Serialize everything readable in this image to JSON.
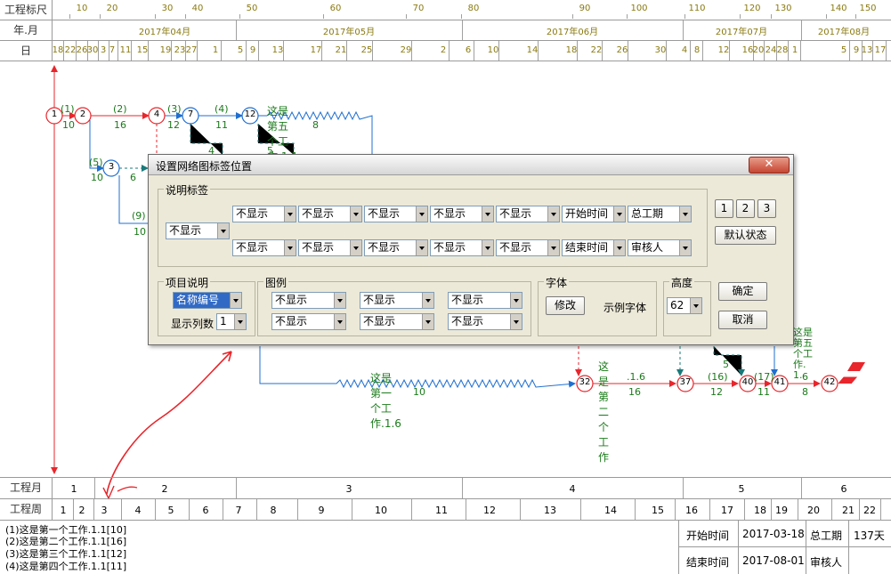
{
  "header": {
    "ruler_label": "工程标尺",
    "ruler_ticks": [
      "10",
      "20",
      "30",
      "40",
      "50",
      "60",
      "70",
      "80",
      "90",
      "100",
      "110",
      "120",
      "130",
      "140",
      "150"
    ],
    "month_label": "年.月",
    "months": [
      "2017年04月",
      "2017年05月",
      "2017年06月",
      "2017年07月",
      "2017年08月"
    ],
    "day_label": "日",
    "days": [
      "18",
      "22",
      "26",
      "30",
      "3",
      "7",
      "11",
      "15",
      "19",
      "23",
      "27",
      "1",
      "5",
      "9",
      "13",
      "17",
      "21",
      "25",
      "29",
      "2",
      "6",
      "10",
      "14",
      "18",
      "22",
      "26",
      "30",
      "4",
      "8",
      "12",
      "16",
      "20",
      "24",
      "28",
      "1",
      "5",
      "9",
      "13",
      "17"
    ]
  },
  "network": {
    "nodes": [
      "1",
      "2",
      "4",
      "7",
      "12",
      "3",
      "32",
      "37",
      "40",
      "41",
      "42"
    ],
    "work_labels": {
      "w1": "(1)",
      "w1_dur": "10",
      "w2": "(2)",
      "w2_dur": "16",
      "w3": "(3)",
      "w3_dur": "12",
      "w4": "(4)",
      "w4_dur": "11",
      "w5_title": "这是第五个工作.1.1",
      "w5_dur": "8",
      "w5b": "(5)",
      "w5b_dur": "10",
      "w6_dur": "6",
      "w9": "(9)",
      "w9_dur": "10",
      "long_title": "这是第一个工作.1.6",
      "long_dur": "10",
      "second_title": "这是第二个工作",
      "second_sub": ".1.6",
      "second_dur": "16",
      "w16": "(16)",
      "w16_dur": "12",
      "w17": "(17)",
      "w17_dur": "11",
      "wfive_vertical": "这是第五个工作.1.",
      "w6b_dur": "6",
      "w8_dur": "8",
      "dash5": "5",
      "dash4": "4",
      "dash5b": "5"
    }
  },
  "dialog": {
    "title": "设置网络图标签位置",
    "close": "✕",
    "desc_group": "说明标签",
    "left_combo": "不显示",
    "top_row": [
      "不显示",
      "不显示",
      "不显示",
      "不显示",
      "不显示",
      "开始时间",
      "总工期"
    ],
    "bottom_row": [
      "不显示",
      "不显示",
      "不显示",
      "不显示",
      "不显示",
      "结束时间",
      "审核人"
    ],
    "num_buttons": [
      "1",
      "2",
      "3"
    ],
    "default_button": "默认状态",
    "item_group": "项目说明",
    "item_combo": "名称编号",
    "columns_label": "显示列数",
    "columns_value": "1",
    "legend_group": "图例",
    "legend_combos": [
      "不显示",
      "不显示",
      "不显示",
      "不显示",
      "不显示",
      "不显示"
    ],
    "font_group": "字体",
    "modify_button": "修改",
    "font_sample": "示例字体",
    "height_group": "高度",
    "height_value": "62",
    "ok_button": "确定",
    "cancel_button": "取消"
  },
  "bottom": {
    "month_label": "工程月",
    "months": [
      "1",
      "2",
      "3",
      "4",
      "5",
      "6"
    ],
    "week_label": "工程周",
    "weeks": [
      "1",
      "2",
      "3",
      "4",
      "5",
      "6",
      "7",
      "8",
      "9",
      "10",
      "11",
      "12",
      "13",
      "14",
      "15",
      "16",
      "17",
      "18",
      "19",
      "20",
      "21",
      "22"
    ],
    "legend": [
      "(1)这是第一个工作.1.1[10]",
      "(2)这是第二个工作.1.1[16]",
      "(3)这是第三个工作.1.1[12]",
      "(4)这是第四个工作.1.1[11]"
    ],
    "start_label": "开始时间",
    "start_value": "2017-03-18",
    "total_label": "总工期",
    "total_value": "137天",
    "end_label": "结束时间",
    "end_value": "2017-08-01",
    "reviewer_label": "审核人"
  },
  "colors": {
    "critical": "#e8262c",
    "normal": "#1f6fd1",
    "label": "#1a7a1a",
    "ruler": "#8a7a10"
  }
}
